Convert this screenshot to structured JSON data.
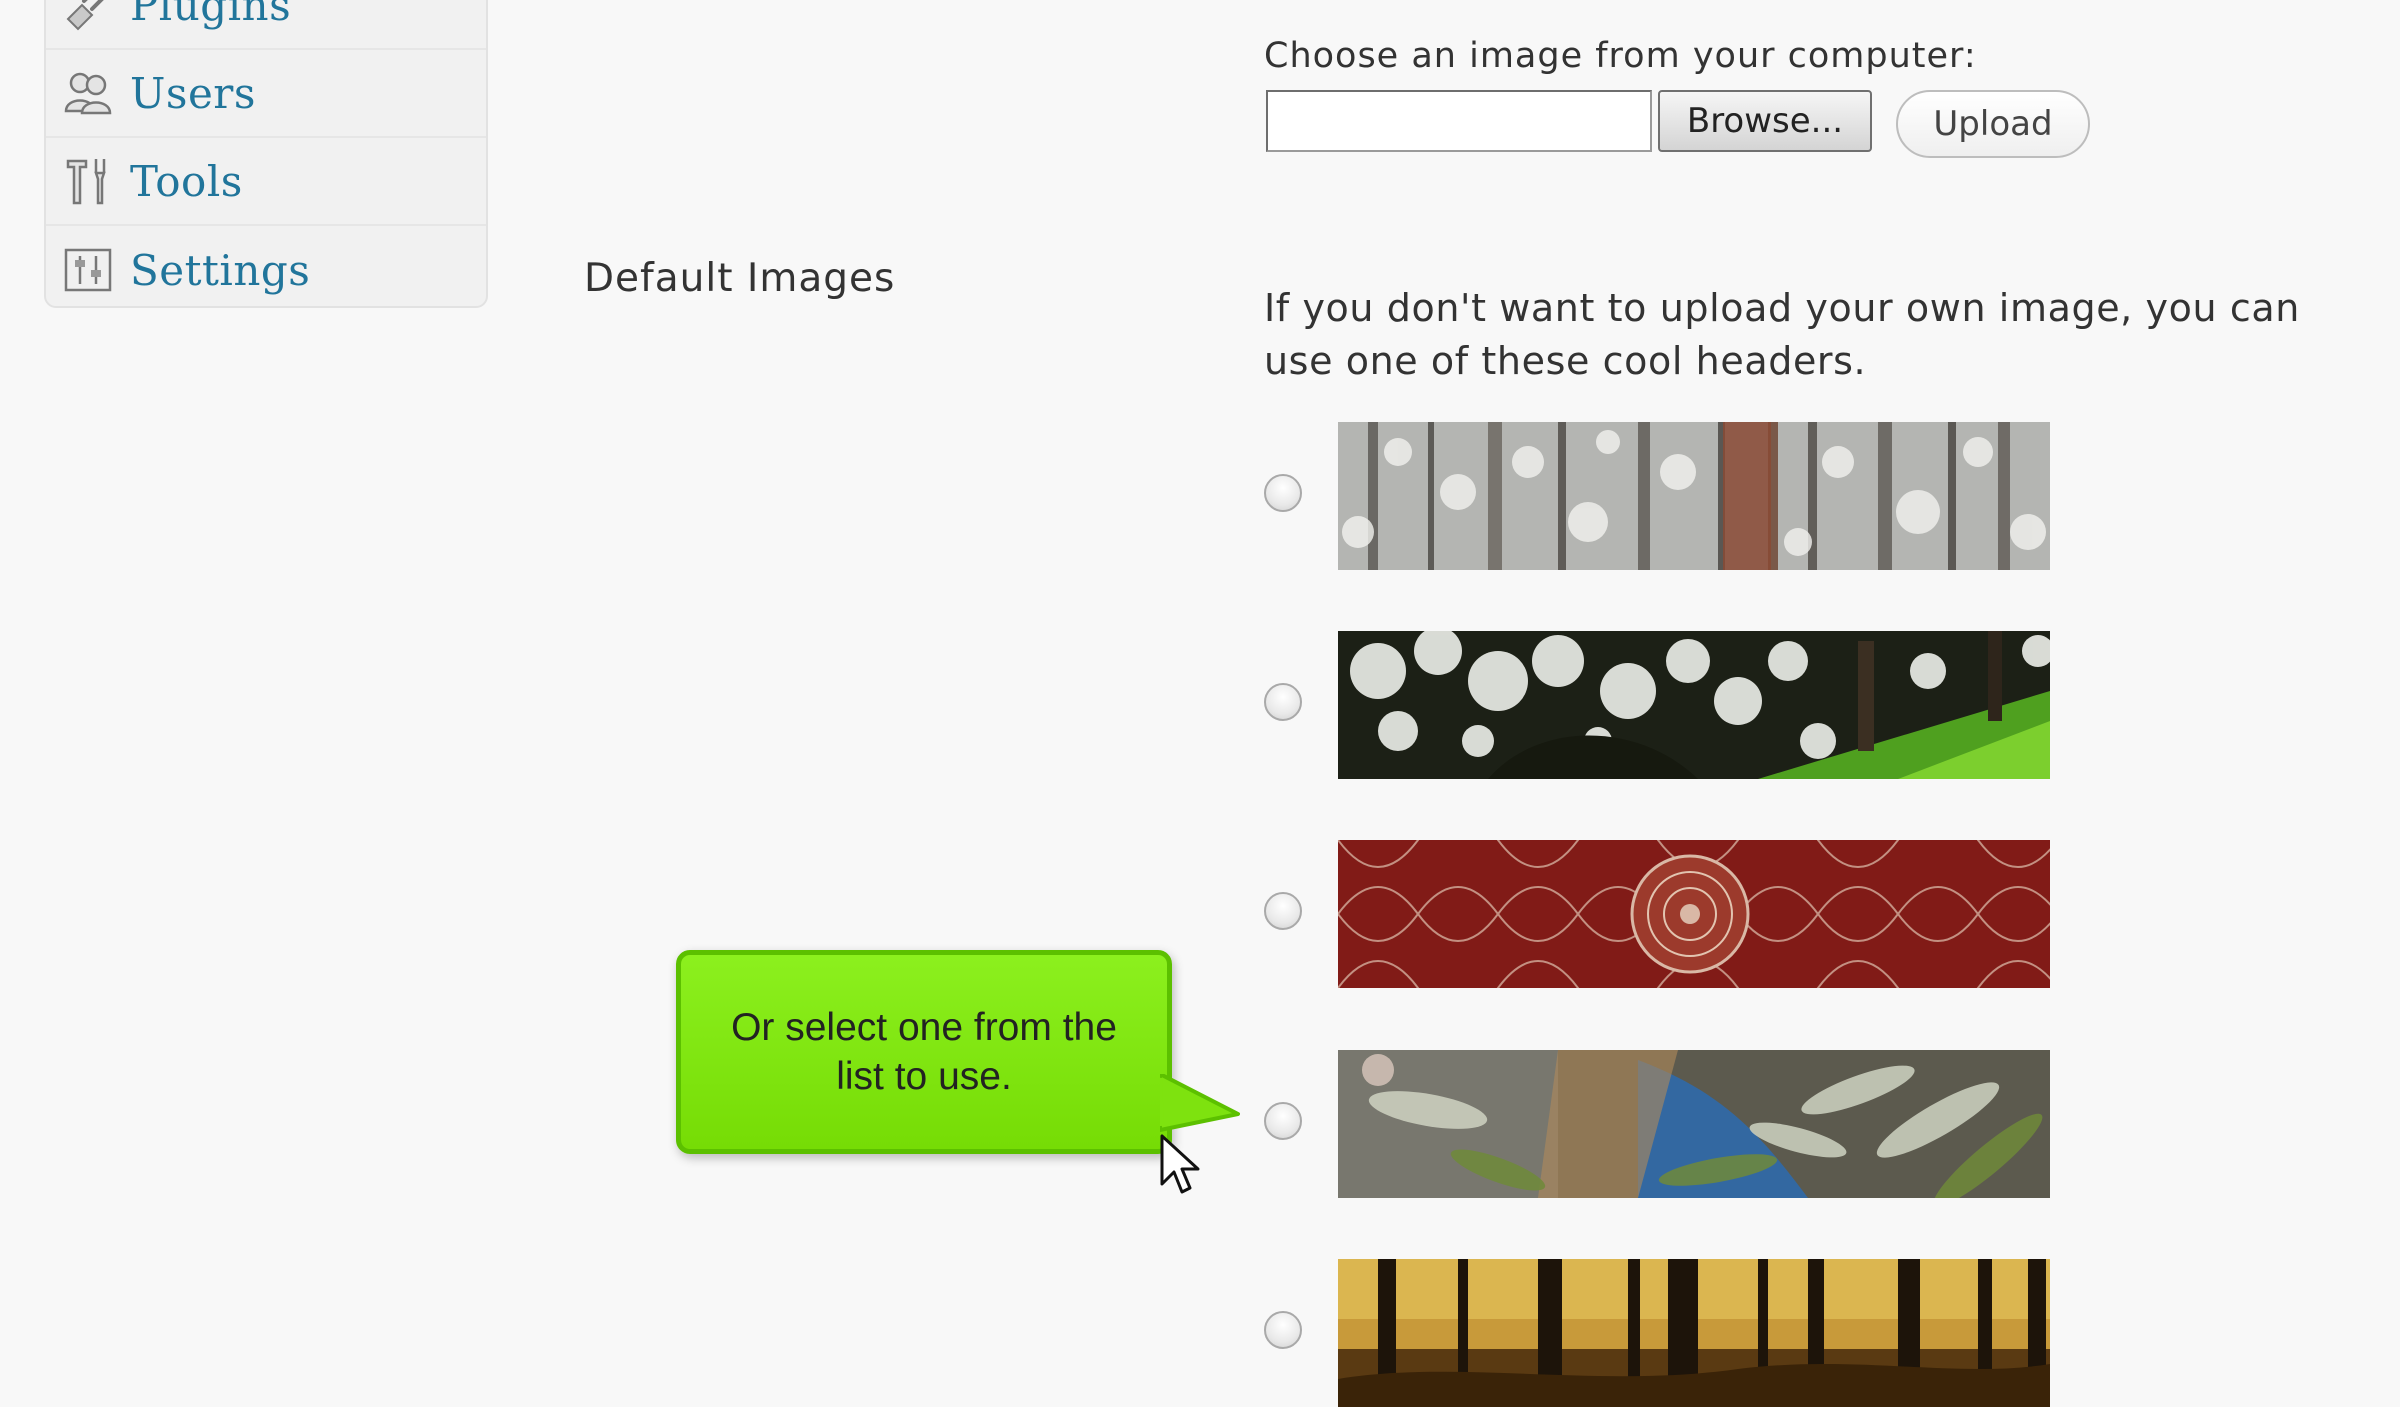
{
  "sidebar": {
    "items": [
      {
        "label": "Plugins",
        "icon": "plugin-icon"
      },
      {
        "label": "Users",
        "icon": "users-icon"
      },
      {
        "label": "Tools",
        "icon": "tools-icon"
      },
      {
        "label": "Settings",
        "icon": "settings-icon"
      }
    ]
  },
  "section": {
    "label": "Default Images"
  },
  "upload": {
    "prompt": "Choose an image from your computer:",
    "file_value": "",
    "browse_label": "Browse...",
    "upload_label": "Upload"
  },
  "default_images": {
    "description": "If you don't want to upload your own image, you can use one of these cool headers.",
    "options": [
      {
        "name": "snowy-forest",
        "selected": false
      },
      {
        "name": "white-blossoms",
        "selected": false
      },
      {
        "name": "red-lattice",
        "selected": false
      },
      {
        "name": "fern-leaves",
        "selected": false
      },
      {
        "name": "autumn-forest",
        "selected": false
      }
    ]
  },
  "callout": {
    "text": "Or select one from the list to use."
  },
  "colors": {
    "link": "#21759b",
    "callout": "#7de80d",
    "background": "#f8f8f8"
  }
}
